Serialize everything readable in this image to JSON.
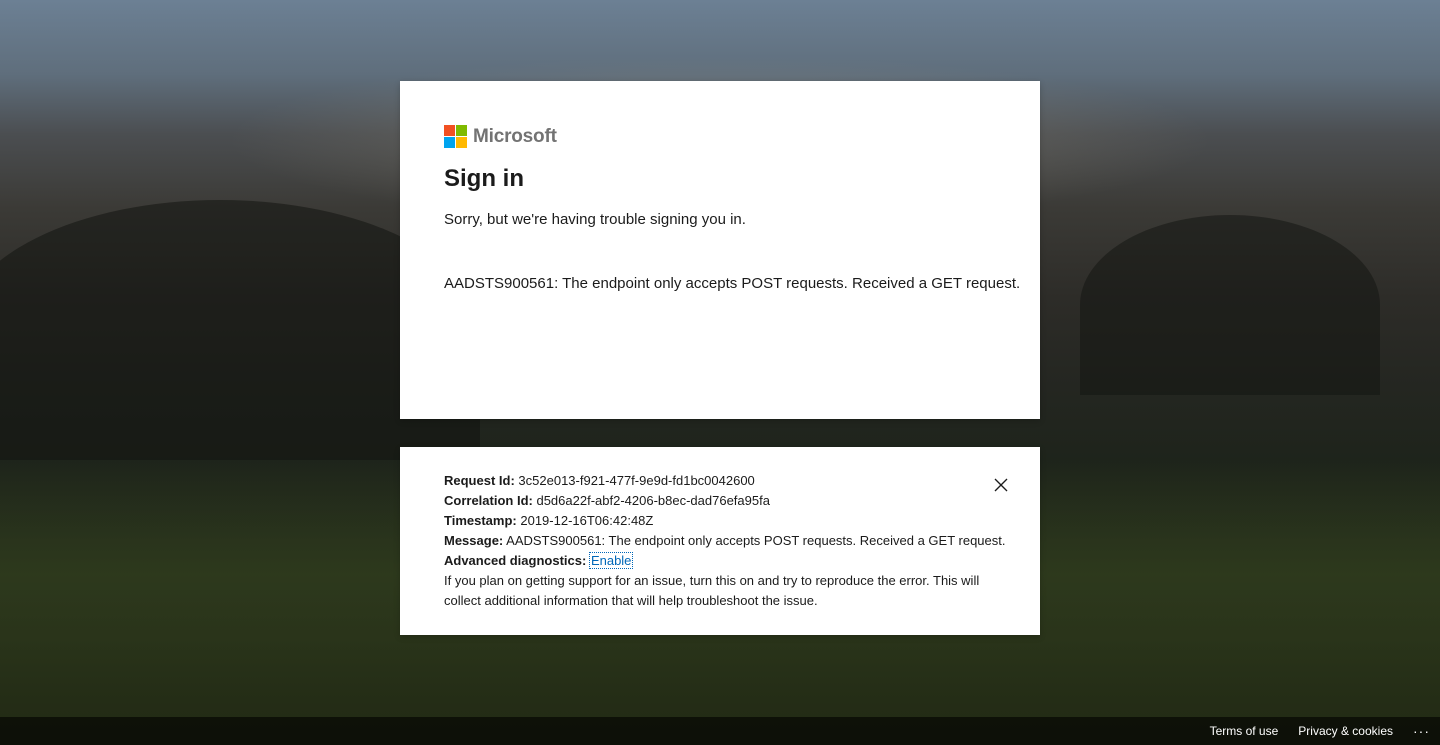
{
  "brand": {
    "name": "Microsoft",
    "logo_colors": [
      "#f25022",
      "#7fba00",
      "#00a4ef",
      "#ffb900"
    ]
  },
  "signin": {
    "title": "Sign in",
    "subtitle": "Sorry, but we're having trouble signing you in.",
    "error_message": "AADSTS900561: The endpoint only accepts POST requests. Received a GET request."
  },
  "details": {
    "request_id_label": "Request Id:",
    "request_id_value": "3c52e013-f921-477f-9e9d-fd1bc0042600",
    "correlation_id_label": "Correlation Id:",
    "correlation_id_value": "d5d6a22f-abf2-4206-b8ec-dad76efa95fa",
    "timestamp_label": "Timestamp:",
    "timestamp_value": "2019-12-16T06:42:48Z",
    "message_label": "Message:",
    "message_value": "AADSTS900561: The endpoint only accepts POST requests. Received a GET request.",
    "advanced_label": "Advanced diagnostics:",
    "enable_link": "Enable",
    "help_text": "If you plan on getting support for an issue, turn this on and try to reproduce the error. This will collect additional information that will help troubleshoot the issue.",
    "close_icon": "close-icon"
  },
  "footer": {
    "terms": "Terms of use",
    "privacy": "Privacy & cookies",
    "more": "···"
  },
  "colors": {
    "link": "#0067b8",
    "card_bg": "#ffffff",
    "text": "#1b1b1b"
  }
}
